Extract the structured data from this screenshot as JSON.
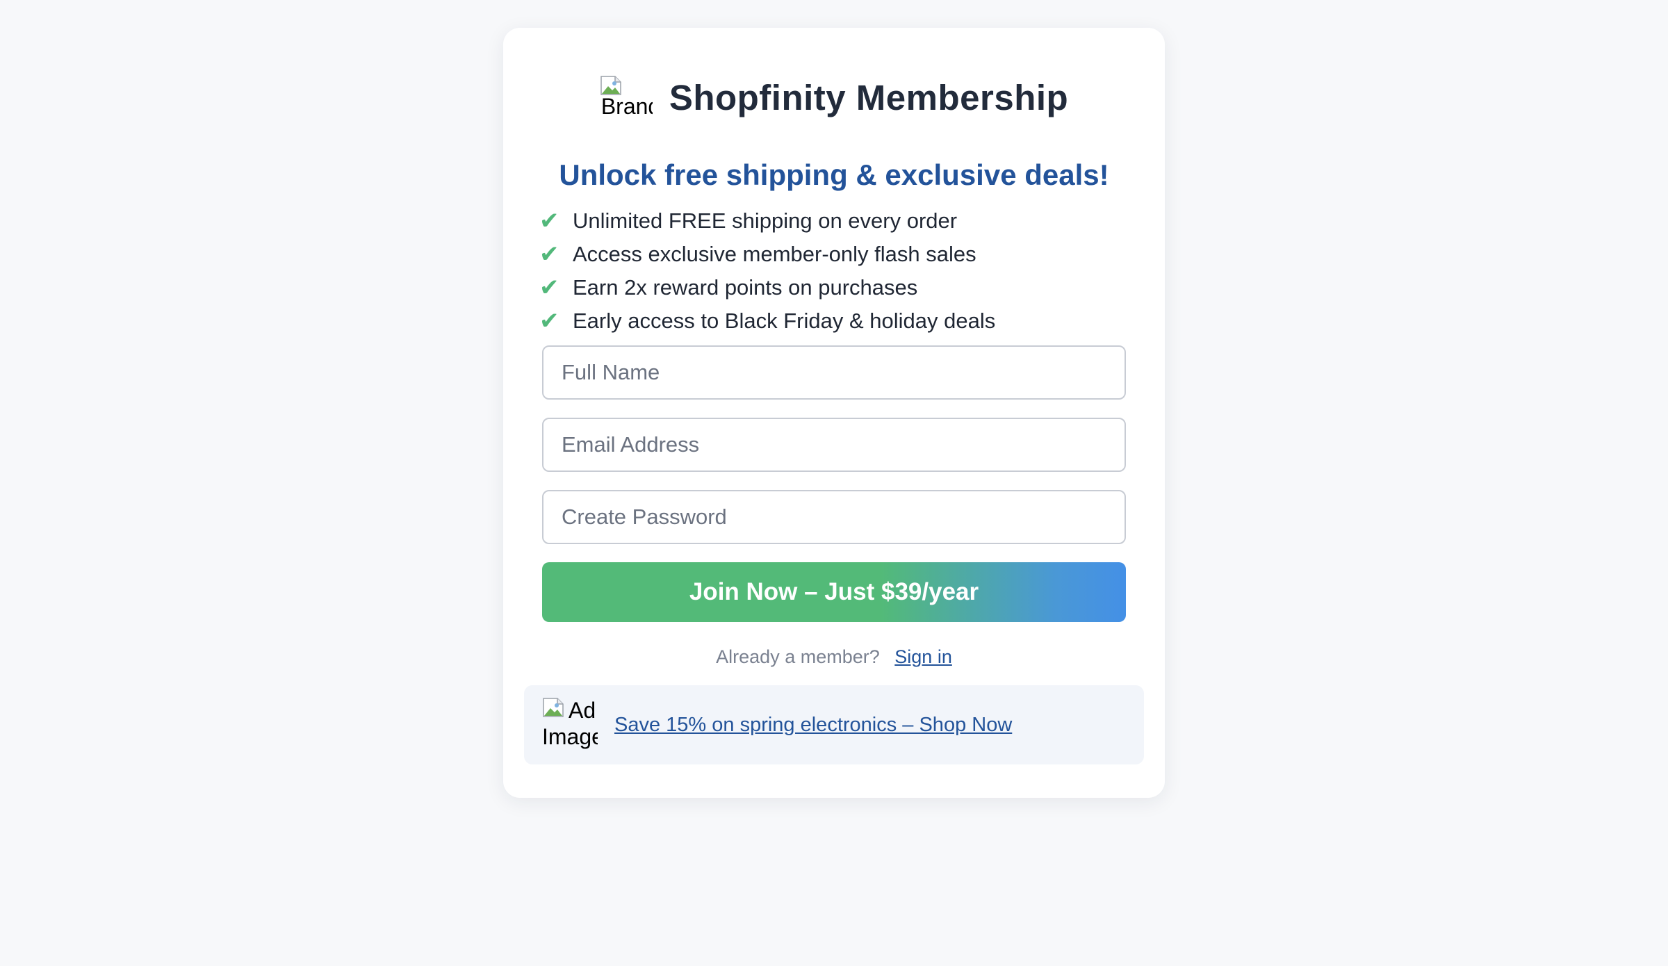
{
  "brand": {
    "logo_alt": "Brand",
    "title": "Shopfinity Membership"
  },
  "tagline": "Unlock free shipping & exclusive deals!",
  "benefits": [
    "Unlimited FREE shipping on every order",
    "Access exclusive member-only flash sales",
    "Earn 2x reward points on purchases",
    "Early access to Black Friday & holiday deals"
  ],
  "form": {
    "full_name": {
      "placeholder": "Full Name",
      "value": ""
    },
    "email": {
      "placeholder": "Email Address",
      "value": ""
    },
    "password": {
      "placeholder": "Create Password",
      "value": ""
    },
    "submit_label": "Join Now – Just $39/year"
  },
  "signin": {
    "prompt": "Already a member?",
    "link_label": "Sign in"
  },
  "ad": {
    "image_alt_line1": "Ad",
    "image_alt_line2": "Image",
    "link_label": "Save 15% on spring electronics – Shop Now"
  },
  "icons": {
    "benefit_check": "check-mark-icon",
    "broken_image": "broken-image-icon"
  },
  "colors": {
    "title": "#222b3b",
    "accent_blue": "#23539a",
    "check_green": "#52b87a",
    "button_green": "#53ba78",
    "button_blue": "#4490e6",
    "page_background": "#f7f8fa",
    "ad_background": "#f2f5fa"
  }
}
